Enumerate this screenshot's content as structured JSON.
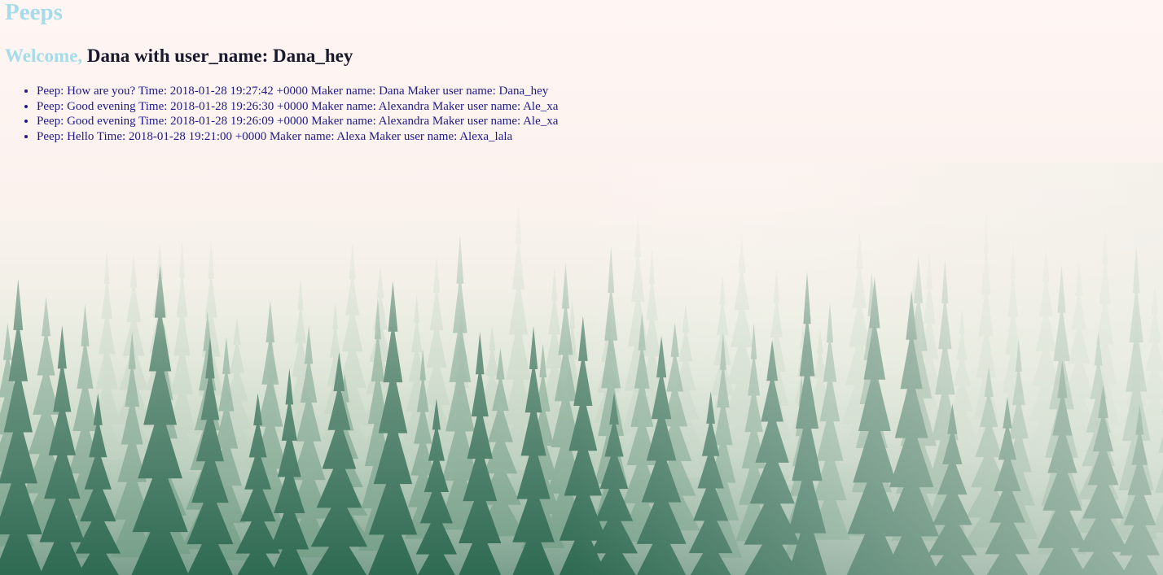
{
  "app": {
    "title": "Peeps"
  },
  "welcome": {
    "prefix": "Welcome,",
    "user_text": "Dana with user_name: Dana_hey"
  },
  "peeps": [
    {
      "text": "Peep: How are you? Time: 2018-01-28 19:27:42 +0000 Maker name: Dana Maker user name: Dana_hey"
    },
    {
      "text": "Peep: Good evening Time: 2018-01-28 19:26:30 +0000 Maker name: Alexandra Maker user name: Ale_xa"
    },
    {
      "text": "Peep: Good evening Time: 2018-01-28 19:26:09 +0000 Maker name: Alexandra Maker user name: Ale_xa"
    },
    {
      "text": "Peep: Hello Time: 2018-01-28 19:21:00 +0000 Maker name: Alexa Maker user name: Alexa_lala"
    }
  ],
  "colors": {
    "title": "#a6dbe9",
    "heading_text": "#1a1a2e",
    "list_text": "#1f1a8a"
  },
  "background": {
    "image": "misty-forest"
  }
}
